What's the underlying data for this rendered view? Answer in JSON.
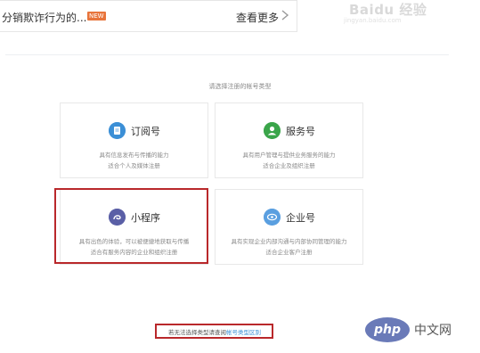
{
  "notice": {
    "text": "分销欺诈行为的...",
    "badge": "NEW",
    "more": "查看更多"
  },
  "watermark": {
    "brand": "Baidu 经验",
    "url": "jingyan.baidu.com"
  },
  "prompt": "请选择注册的帐号类型",
  "cards": [
    {
      "title": "订阅号",
      "icon": "document-icon",
      "desc1": "具有信息发布与传播的能力",
      "desc2": "适合个人及媒体注册"
    },
    {
      "title": "服务号",
      "icon": "person-icon",
      "desc1": "具有用户管理与提供业务服务的能力",
      "desc2": "适合企业及组织注册"
    },
    {
      "title": "小程序",
      "icon": "mini-program-icon",
      "desc1": "具有出色的体验，可以被便捷地获取与传播",
      "desc2": "适合有服务内容的企业和组织注册"
    },
    {
      "title": "企业号",
      "icon": "enterprise-icon",
      "desc1": "具有实现企业内部沟通与内部协同管理的能力",
      "desc2": "适合企业客户注册"
    }
  ],
  "footer": {
    "text": "若无法选择类型请查阅",
    "link": "帐号类型区别"
  },
  "php": {
    "logo": "php",
    "text": "中文网"
  },
  "colors": {
    "highlight": "#b9282b",
    "link": "#3a8fd6",
    "subscription": "#3b8fd6",
    "service": "#3aa54a",
    "mini_program": "#5a5fa6",
    "enterprise": "#5a9fe0"
  }
}
